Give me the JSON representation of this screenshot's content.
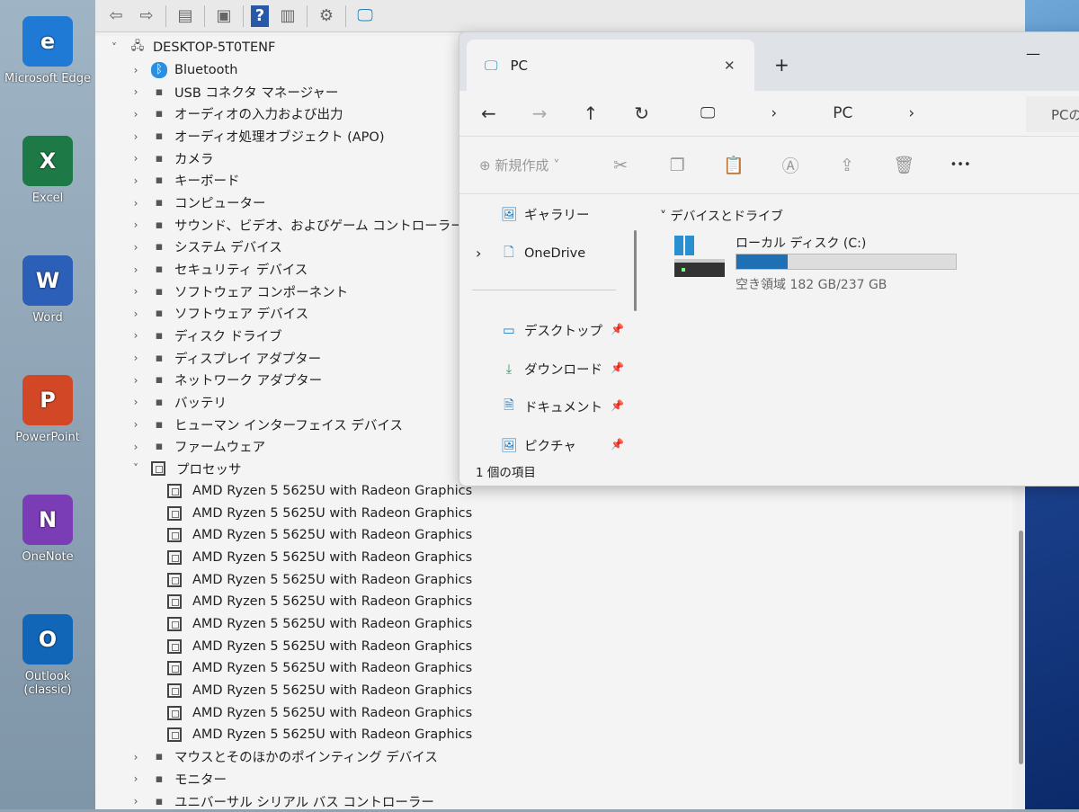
{
  "desktop": {
    "icons": [
      {
        "label": "Microsoft Edge",
        "glyph": "e",
        "color": "#1f7ad6"
      },
      {
        "label": "Excel",
        "glyph": "X",
        "color": "#1d7a46"
      },
      {
        "label": "Word",
        "glyph": "W",
        "color": "#2b5fb8"
      },
      {
        "label": "PowerPoint",
        "glyph": "P",
        "color": "#d24726"
      },
      {
        "label": "OneNote",
        "glyph": "N",
        "color": "#7b3db5"
      },
      {
        "label": "Outlook (classic)",
        "glyph": "O",
        "color": "#1266b8"
      }
    ]
  },
  "device_manager": {
    "root": "DESKTOP-5T0TENF",
    "categories": [
      "Bluetooth",
      "USB コネクタ マネージャー",
      "オーディオの入力および出力",
      "オーディオ処理オブジェクト (APO)",
      "カメラ",
      "キーボード",
      "コンピューター",
      "サウンド、ビデオ、およびゲーム コントローラー",
      "システム デバイス",
      "セキュリティ デバイス",
      "ソフトウェア コンポーネント",
      "ソフトウェア デバイス",
      "ディスク ドライブ",
      "ディスプレイ アダプター",
      "ネットワーク アダプター",
      "バッテリ",
      "ヒューマン インターフェイス デバイス",
      "ファームウェア",
      "プロセッサ"
    ],
    "processors": [
      "AMD Ryzen 5 5625U with Radeon Graphics",
      "AMD Ryzen 5 5625U with Radeon Graphics",
      "AMD Ryzen 5 5625U with Radeon Graphics",
      "AMD Ryzen 5 5625U with Radeon Graphics",
      "AMD Ryzen 5 5625U with Radeon Graphics",
      "AMD Ryzen 5 5625U with Radeon Graphics",
      "AMD Ryzen 5 5625U with Radeon Graphics",
      "AMD Ryzen 5 5625U with Radeon Graphics",
      "AMD Ryzen 5 5625U with Radeon Graphics",
      "AMD Ryzen 5 5625U with Radeon Graphics",
      "AMD Ryzen 5 5625U with Radeon Graphics",
      "AMD Ryzen 5 5625U with Radeon Graphics"
    ],
    "after": [
      "マウスとそのほかのポインティング デバイス",
      "モニター",
      "ユニバーサル シリアル バス コントローラー"
    ]
  },
  "explorer": {
    "tab_title": "PC",
    "close": "✕",
    "new_tab": "+",
    "breadcrumb": "PC",
    "search_placeholder": "PCの",
    "new_label": "新規作成",
    "more": "•••",
    "sidebar": [
      {
        "label": "ギャラリー"
      },
      {
        "label": "OneDrive"
      },
      {
        "label": "デスクトップ"
      },
      {
        "label": "ダウンロード"
      },
      {
        "label": "ドキュメント"
      },
      {
        "label": "ピクチャ"
      }
    ],
    "section": "デバイスとドライブ",
    "drive": {
      "name": "ローカル ディスク (C:)",
      "free": "空き領域 182 GB/237 GB",
      "used_fraction": 0.232
    },
    "status": "1 個の項目",
    "accent": "#1f6fb5"
  }
}
